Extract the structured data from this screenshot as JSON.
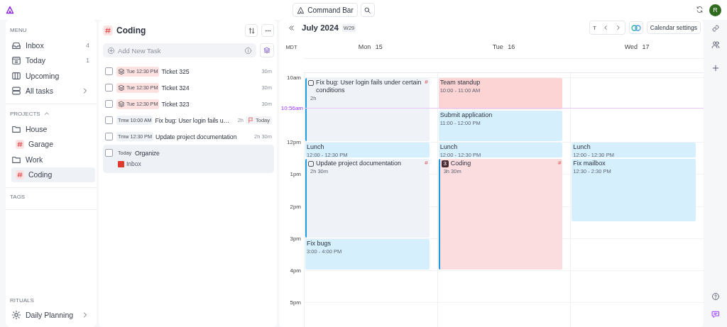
{
  "topbar": {
    "command_bar": "Command Bar",
    "avatar": "R"
  },
  "sidebar": {
    "menu_heading": "MENU",
    "menu": [
      {
        "label": "Inbox",
        "count": "4",
        "chevron": false
      },
      {
        "label": "Today",
        "count": "1",
        "chevron": false
      },
      {
        "label": "Upcoming",
        "chevron": false
      },
      {
        "label": "All tasks",
        "chevron": true
      }
    ],
    "projects_heading": "PROJECTS",
    "projects": [
      {
        "label": "House",
        "kind": "folder",
        "selected": false,
        "children": [
          {
            "label": "Garage",
            "kind": "tag",
            "selected": false
          }
        ]
      },
      {
        "label": "Work",
        "kind": "folder",
        "selected": false,
        "children": [
          {
            "label": "Coding",
            "kind": "tag",
            "selected": true
          }
        ]
      }
    ],
    "tags_heading": "TAGS",
    "rituals_heading": "RITUALS",
    "rituals": [
      {
        "label": "Daily Planning"
      }
    ]
  },
  "tasks_panel": {
    "title": "Coding",
    "add_placeholder": "Add New Task",
    "tasks": [
      {
        "date": "Tue 12:30 PM",
        "kind": "stacked",
        "title": "Ticket 325",
        "duration": "30m",
        "checked": false,
        "selected": false
      },
      {
        "date": "Tue 12:30 PM",
        "kind": "stacked",
        "title": "Ticket 324",
        "duration": "30m",
        "checked": false,
        "selected": false
      },
      {
        "date": "Tue 12:30 PM",
        "kind": "stacked",
        "title": "Ticket 323",
        "duration": "30m",
        "checked": false,
        "selected": false
      },
      {
        "date": "Tmw 10:00 AM",
        "kind": "plain",
        "title": "Fix bug: User login fails u…",
        "duration": "2h",
        "flag": "Today",
        "checked": false,
        "selected": false
      },
      {
        "date": "Tmw 12:30 PM",
        "kind": "plain",
        "title": "Update project documentation",
        "duration": "2h 30m",
        "checked": false,
        "selected": false
      },
      {
        "date": "Today",
        "kind": "plain",
        "title": "Organize",
        "project": "Inbox",
        "checked": false,
        "selected": true
      }
    ]
  },
  "calendar": {
    "month": "July 2024",
    "week": "W29",
    "today_button": "T",
    "settings": "Calendar settings",
    "timezone": "MDT",
    "hours": [
      "10am",
      "12pm",
      "1pm",
      "2pm",
      "3pm",
      "4pm",
      "5pm"
    ],
    "now": "10:56am",
    "days": [
      {
        "label": "Mon 15",
        "events": [
          {
            "kind": "task",
            "title": "Fix bug: User login fails under certain conditions",
            "detail": "2h",
            "tag": "#",
            "color": "#eff3f8"
          },
          {
            "kind": "event",
            "title": "Lunch",
            "detail": "12:00 - 12:30 PM",
            "color": "#d6effc"
          },
          {
            "kind": "task",
            "title": "Update project documentation",
            "detail": "2h 30m",
            "tag": "#",
            "color": "#eff3f8"
          },
          {
            "kind": "event",
            "title": "Fix bugs",
            "detail": "3:00 - 4:00 PM",
            "color": "#d6effc"
          }
        ]
      },
      {
        "label": "Tue 16",
        "events": [
          {
            "kind": "event",
            "title": "Team standup",
            "detail": "10:00 - 11:00 AM",
            "color": "#fdd4d4"
          },
          {
            "kind": "event",
            "title": "Submit application",
            "detail": "11:00 - 12:00 PM",
            "color": "#d6effc"
          },
          {
            "kind": "event",
            "title": "Lunch",
            "detail": "12:00 - 12:30 PM",
            "color": "#d6effc"
          },
          {
            "kind": "project",
            "badge": "3",
            "title": "Coding",
            "detail": "3h 30m",
            "tag": "#",
            "color": "#fbdde0"
          }
        ]
      },
      {
        "label": "Wed 17",
        "events": [
          {
            "kind": "event",
            "title": "Lunch",
            "detail": "12:00 - 12:30 PM",
            "color": "#d6effc"
          },
          {
            "kind": "event",
            "title": "Fix mailbox",
            "detail": "12:30 - 2:30 PM",
            "color": "#d6effc"
          }
        ]
      }
    ]
  }
}
